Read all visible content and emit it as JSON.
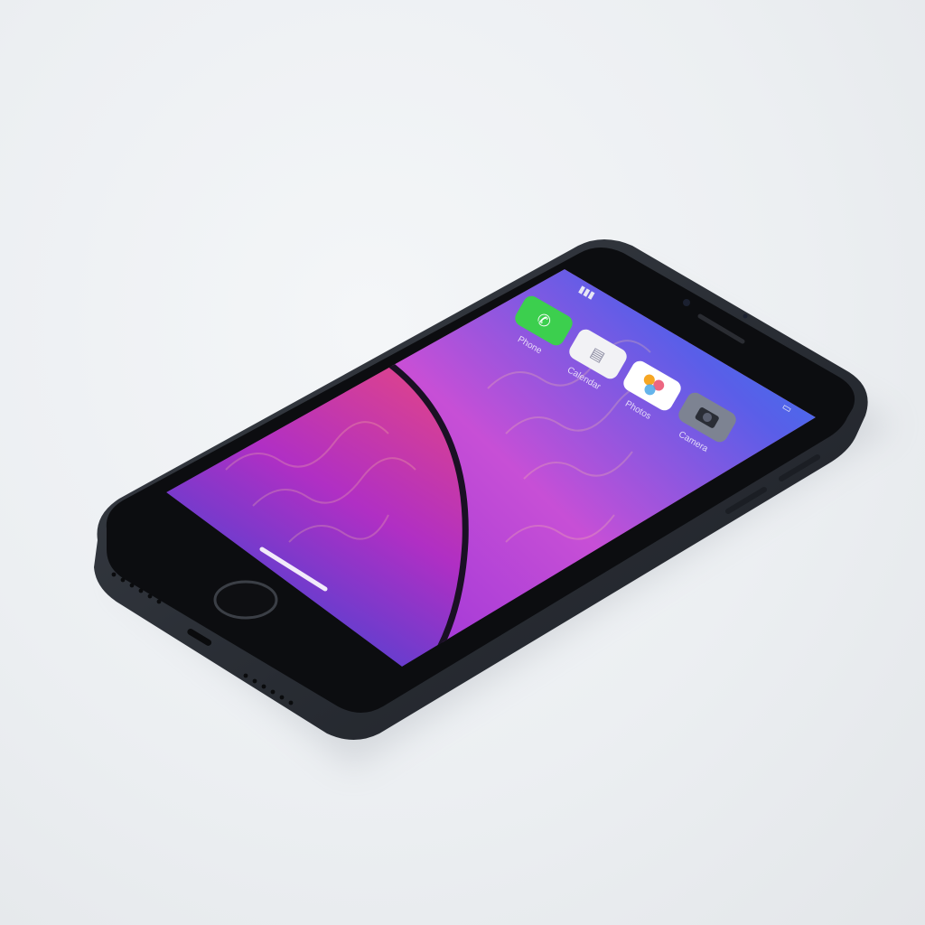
{
  "scene": {
    "subject": "smartphone",
    "background_color": "#eef0f2",
    "body_color": "#2f333a",
    "bezel_color": "#0b0b0d"
  },
  "screen": {
    "wallpaper_colors": [
      "#1e4bd8",
      "#7a2bd6",
      "#e23a8e",
      "#f5874a",
      "#f7c266"
    ],
    "status_bar": {
      "carrier_glyph": "☎",
      "battery_icon": "battery-icon",
      "signal_icon": "signal-icon"
    },
    "apps": [
      {
        "label": "Phone",
        "icon": "phone-icon",
        "color": "#3ccf4e"
      },
      {
        "label": "Calendar",
        "icon": "calendar-icon",
        "color": "#f2f2f5"
      },
      {
        "label": "Photos",
        "icon": "photos-icon",
        "color": "#ffffff"
      },
      {
        "label": "Camera",
        "icon": "camera-icon",
        "color": "#7d8392"
      }
    ],
    "home_indicator": "home-indicator"
  }
}
